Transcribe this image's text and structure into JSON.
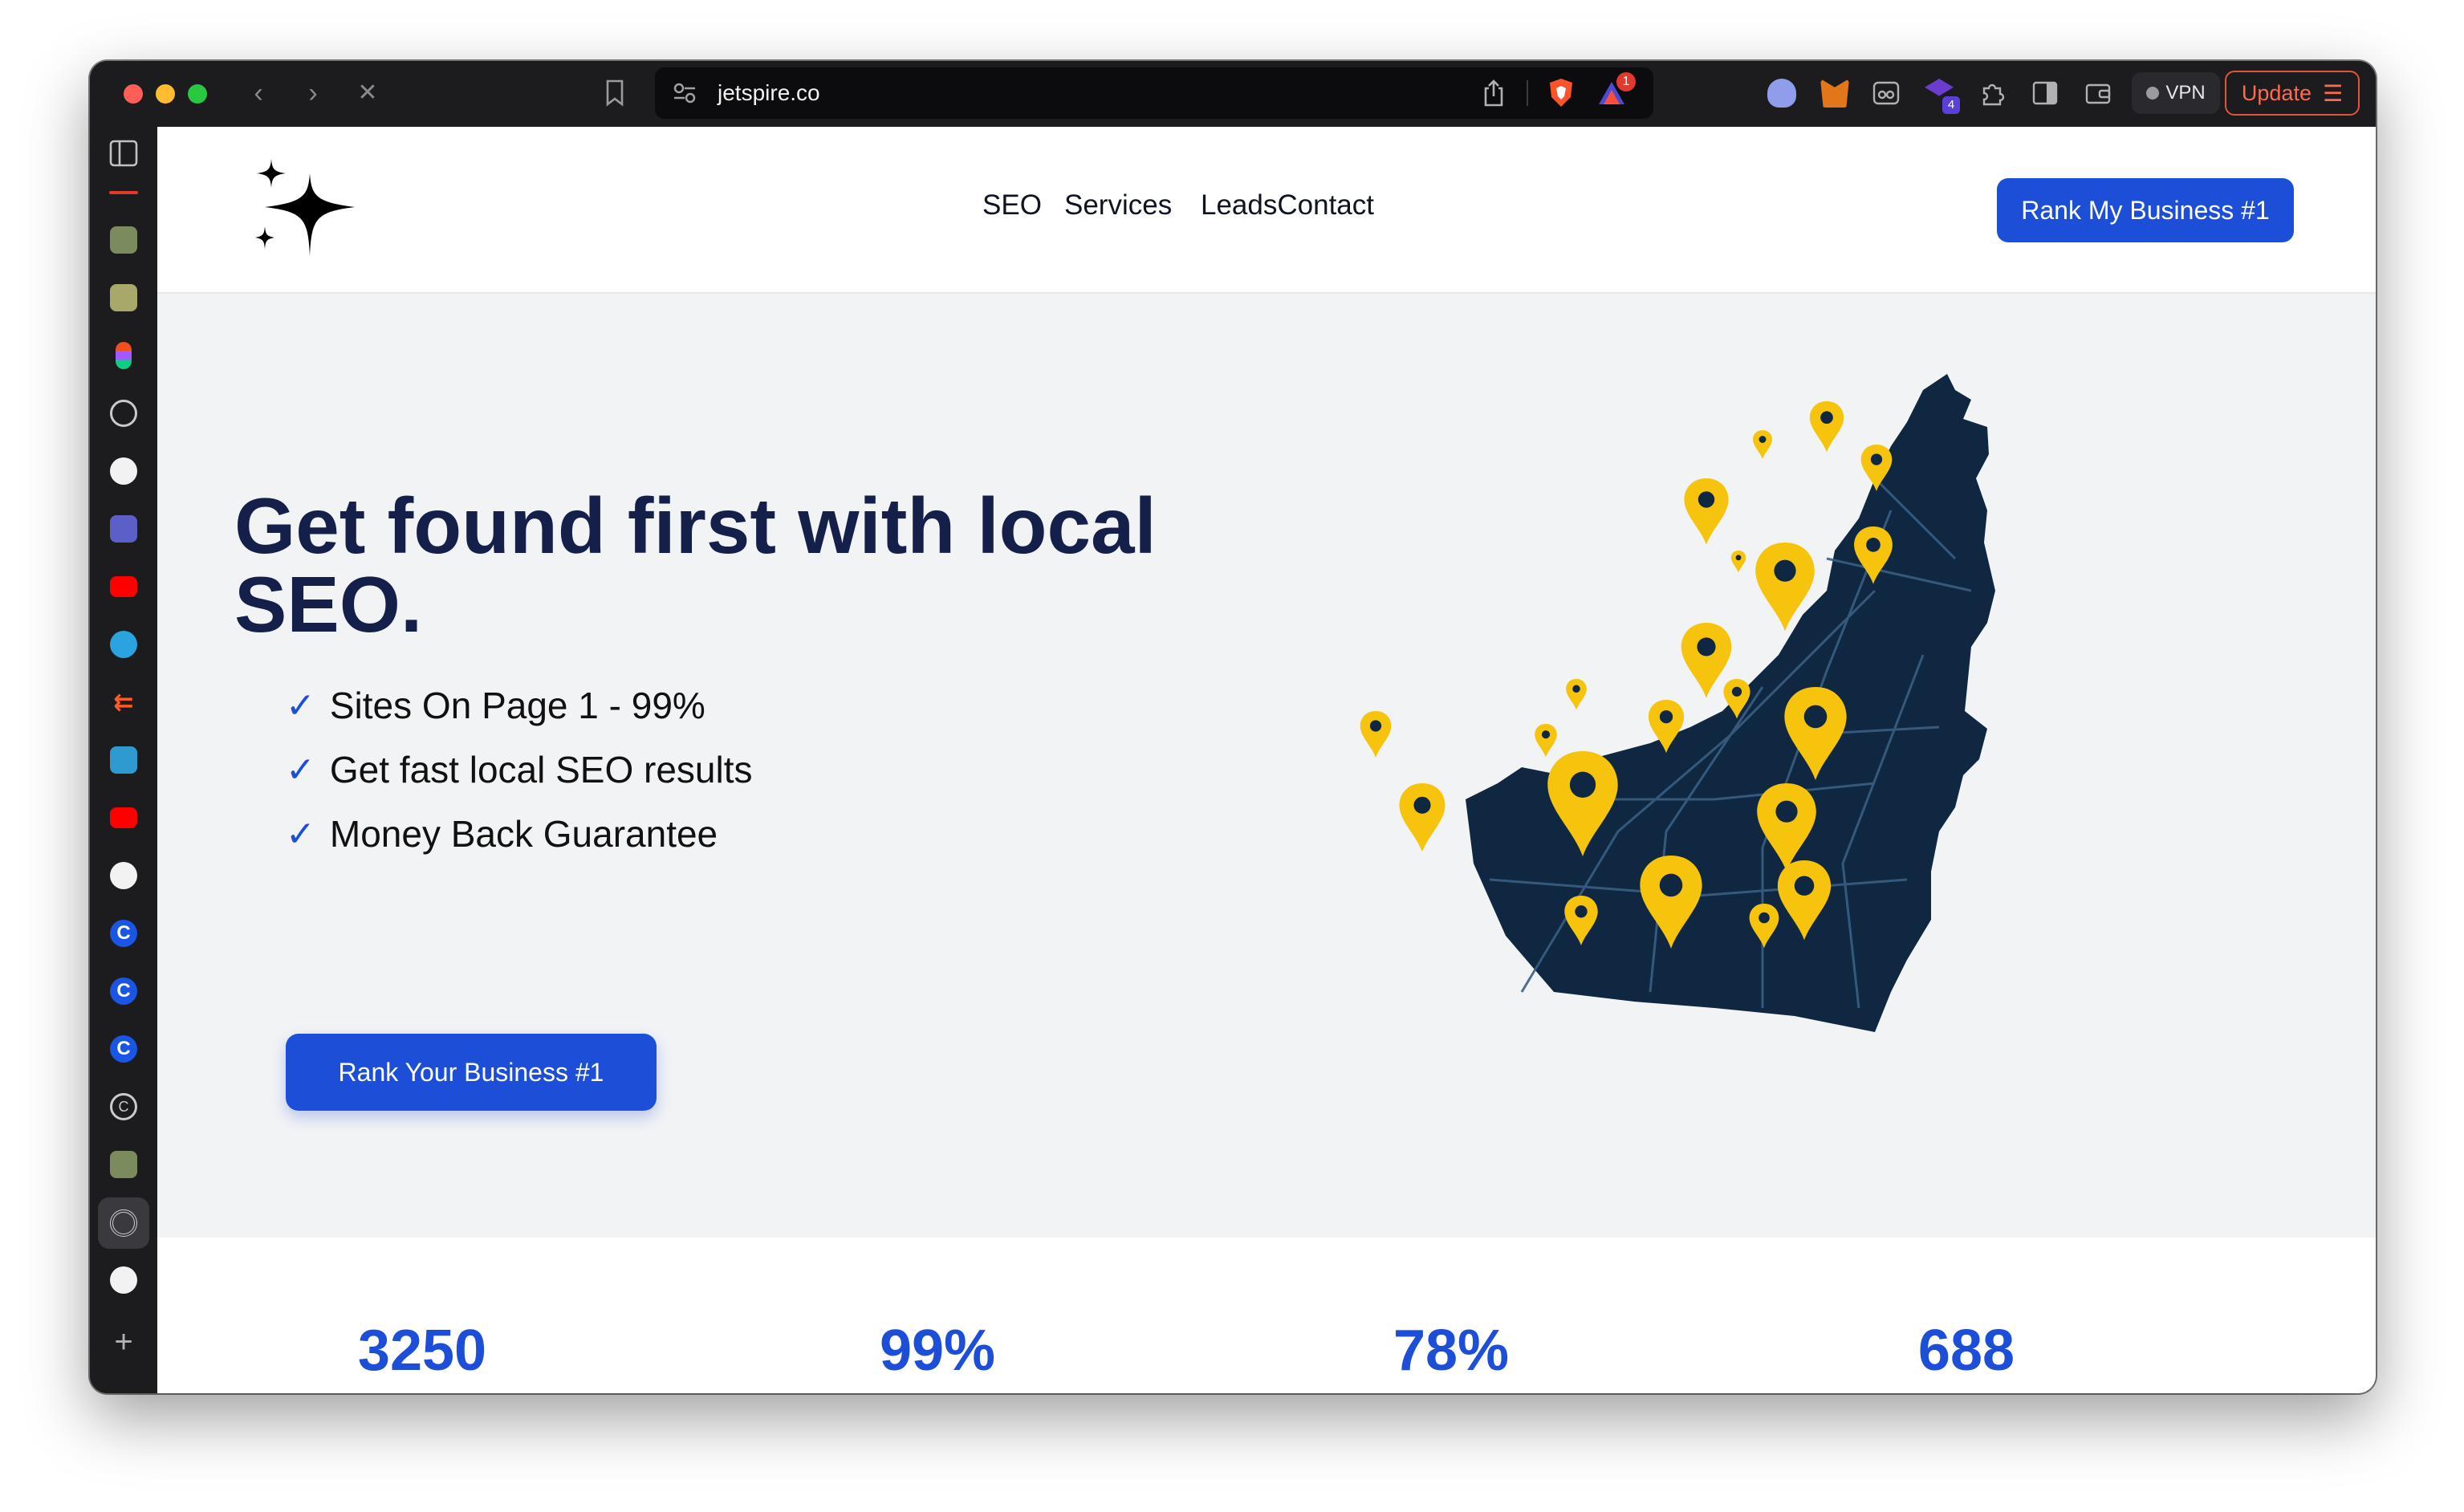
{
  "browser": {
    "url": "jetspire.co",
    "vpn_label": "VPN",
    "update_label": "Update",
    "shield_badge": "1",
    "ext_badge": "4"
  },
  "site": {
    "nav": [
      "SEO",
      "Services",
      "LeadsContact"
    ],
    "header_cta": "Rank My Business #1",
    "hero": {
      "title_line1": "Get found first with local",
      "title_line2": "SEO.",
      "features": [
        "Sites On Page 1 - 99%",
        "Get fast local SEO results",
        "Money Back Guarantee"
      ],
      "check_glyph": "✓",
      "cta": "Rank Your Business #1"
    },
    "stats": [
      "3250",
      "99%",
      "78%",
      "688"
    ]
  },
  "colors": {
    "accent": "#1d4ed8",
    "heading": "#15204a",
    "map": "#0f2740",
    "pin": "#f6c40d"
  },
  "icons": {
    "logo": "sparkle-logo-icon",
    "sidebar": [
      "sidebar-toggle-icon",
      "tab-icon",
      "calendar-icon",
      "figma-icon",
      "circle-dots-icon",
      "github-icon",
      "teams-icon",
      "youtube-icon",
      "telegram-icon",
      "brand-icon",
      "contacts-icon",
      "youtube-icon",
      "openai-icon",
      "c-icon",
      "c-icon",
      "c-icon",
      "c-outline-icon",
      "tab-icon",
      "spiral-icon",
      "triangle-icon",
      "plus-icon"
    ]
  }
}
